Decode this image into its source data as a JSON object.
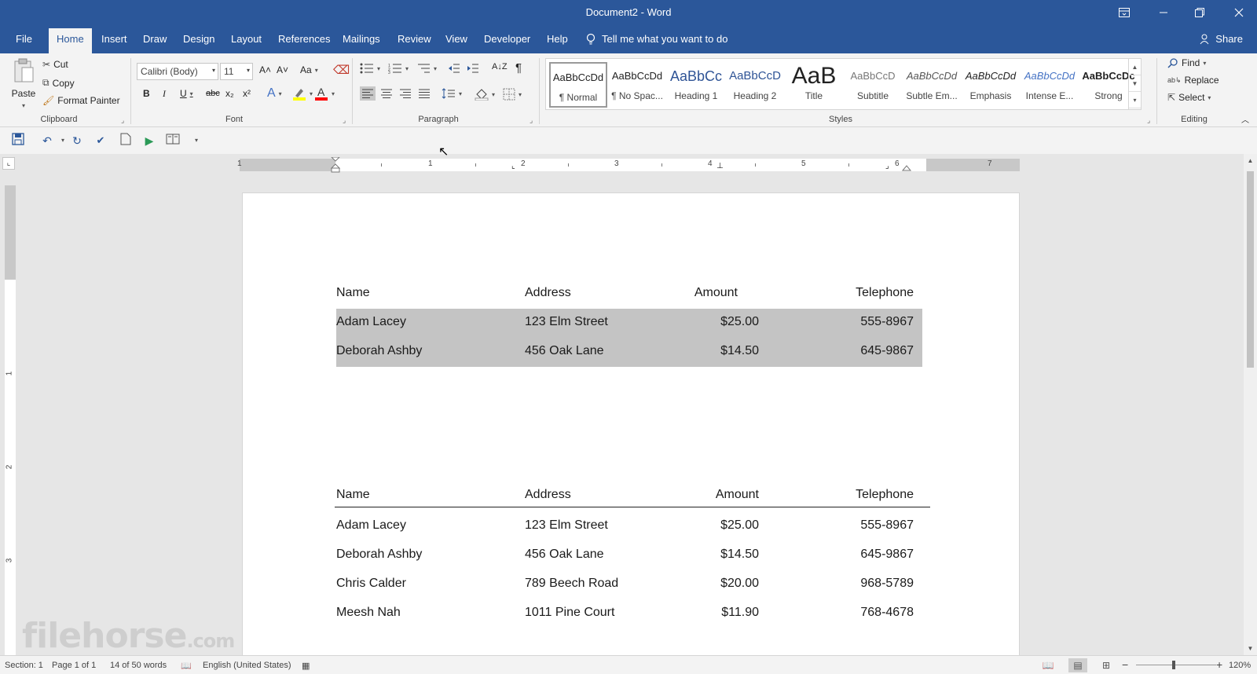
{
  "window": {
    "title": "Document2  -  Word",
    "controls": [
      "ribbon-display-options",
      "minimize",
      "restore",
      "close"
    ]
  },
  "tabs": [
    "File",
    "Home",
    "Insert",
    "Draw",
    "Design",
    "Layout",
    "References",
    "Mailings",
    "Review",
    "View",
    "Developer",
    "Help"
  ],
  "active_tab": "Home",
  "tell_me": "Tell me what you want to do",
  "share": "Share",
  "clipboard": {
    "paste": "Paste",
    "cut": "Cut",
    "copy": "Copy",
    "format_painter": "Format Painter",
    "label": "Clipboard"
  },
  "font": {
    "family": "Calibri (Body)",
    "size": "11",
    "label": "Font",
    "bold": "B",
    "italic": "I",
    "underline": "U",
    "strike": "abc",
    "subscript": "x₂",
    "superscript": "x²",
    "grow": "A˄",
    "shrink": "A˅",
    "case": "Aa",
    "highlight_color": "#ffff00",
    "font_color": "#ff0000"
  },
  "paragraph": {
    "label": "Paragraph"
  },
  "styles": {
    "label": "Styles",
    "items": [
      {
        "sample": "AaBbCcDd",
        "name": "¶ Normal",
        "selected": true
      },
      {
        "sample": "AaBbCcDd",
        "name": "¶ No Spac..."
      },
      {
        "sample": "AaBbCc",
        "name": "Heading 1"
      },
      {
        "sample": "AaBbCcD",
        "name": "Heading 2"
      },
      {
        "sample": "AaB",
        "name": "Title"
      },
      {
        "sample": "AaBbCcD",
        "name": "Subtitle"
      },
      {
        "sample": "AaBbCcDd",
        "name": "Subtle Em..."
      },
      {
        "sample": "AaBbCcDd",
        "name": "Emphasis"
      },
      {
        "sample": "AaBbCcDd",
        "name": "Intense E..."
      },
      {
        "sample": "AaBbCcDc",
        "name": "Strong"
      }
    ]
  },
  "editing": {
    "label": "Editing",
    "find": "Find",
    "replace": "Replace",
    "select": "Select"
  },
  "ruler": {
    "h_numbers": [
      "1",
      "1",
      "2",
      "3",
      "4",
      "5",
      "6",
      "7"
    ],
    "v_numbers": [
      "1",
      "1",
      "2",
      "3"
    ]
  },
  "table1": {
    "headers": [
      "Name",
      "Address",
      "Amount",
      "Telephone"
    ],
    "rows": [
      [
        "Adam Lacey",
        "123 Elm Street",
        "$25.00",
        "555-8967"
      ],
      [
        "Deborah Ashby",
        "456 Oak Lane",
        "$14.50",
        "645-9867"
      ]
    ]
  },
  "table2": {
    "headers": [
      "Name",
      "Address",
      "Amount",
      "Telephone"
    ],
    "rows": [
      [
        "Adam Lacey",
        "123 Elm Street",
        "$25.00",
        "555-8967"
      ],
      [
        "Deborah Ashby",
        "456 Oak Lane",
        "$14.50",
        "645-9867"
      ],
      [
        "Chris Calder",
        "789 Beech Road",
        "$20.00",
        "968-5789"
      ],
      [
        "Meesh Nah",
        "1011 Pine Court",
        "$11.90",
        "768-4678"
      ]
    ]
  },
  "status": {
    "section": "Section: 1",
    "page": "Page 1 of 1",
    "words": "14 of 50 words",
    "language": "English (United States)",
    "zoom": "120%"
  },
  "watermark": {
    "main": "filehorse",
    "suffix": ".com"
  }
}
